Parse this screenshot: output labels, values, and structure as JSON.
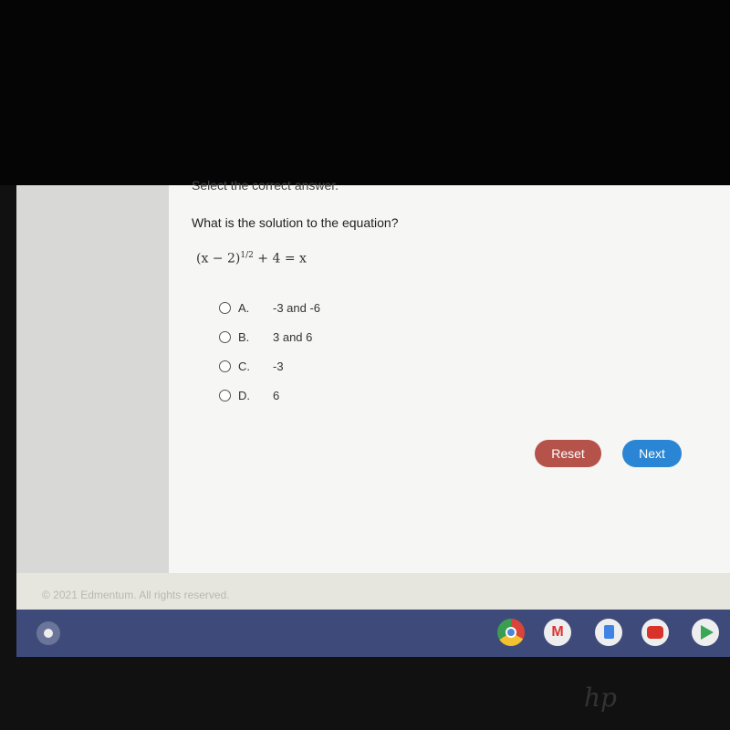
{
  "question": {
    "instruction": "Select the correct answer.",
    "prompt": "What is the solution to the equation?",
    "equation_base": "(x − 2)",
    "equation_exponent": "1/2",
    "equation_rest": " + 4 = x"
  },
  "options": [
    {
      "letter": "A.",
      "text": "-3 and -6"
    },
    {
      "letter": "B.",
      "text": "3 and 6"
    },
    {
      "letter": "C.",
      "text": "-3"
    },
    {
      "letter": "D.",
      "text": "6"
    }
  ],
  "buttons": {
    "reset": "Reset",
    "next": "Next"
  },
  "colors": {
    "reset": "#b5524a",
    "next": "#2a86d4",
    "taskbar": "#3e4a7a"
  },
  "footer": {
    "copyright": "© 2021 Edmentum. All rights reserved."
  },
  "taskbar": {
    "apps": [
      "chrome-icon",
      "gmail-icon",
      "docs-icon",
      "youtube-icon",
      "play-store-icon"
    ]
  },
  "bezel": {
    "logo": "hp"
  }
}
